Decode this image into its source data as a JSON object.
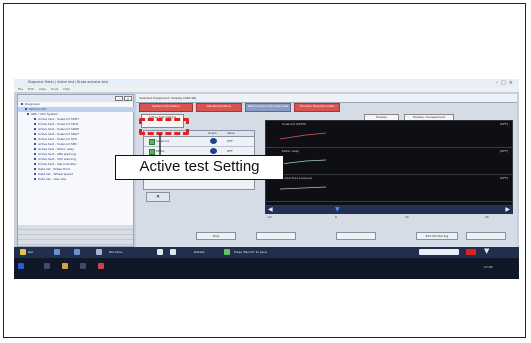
{
  "callout": {
    "label": "Active test Setting"
  },
  "window": {
    "title": "Diagnosis Tester | Active test | Brake actuator test",
    "menu": [
      "File",
      "Edit",
      "View",
      "Tools",
      "Help"
    ]
  },
  "tree": {
    "items": [
      "Diagnosis",
      "Vehicle info",
      "ABS / VSC System",
      "Active test - Solenoid SFRH",
      "Active test - Solenoid SFLH",
      "Active test - Solenoid SRRH",
      "Active test - Solenoid SRLH",
      "Active test - Solenoid STR",
      "Active test - Solenoid SMC",
      "Active test - Motor relay",
      "Active test - ABS warning",
      "Active test - VSC warning",
      "Active test - Slip indicator",
      "Data list - Brake fluid",
      "Data list - Wheel speed",
      "Data list - Yaw rate"
    ],
    "lower_rows": [
      "",
      "",
      "",
      ""
    ]
  },
  "header": {
    "title": "Selected Equipment: Display (ABS SB)"
  },
  "tabs": [
    {
      "label": "System Information"
    },
    {
      "label": "Adjustment Menu"
    },
    {
      "label": "Data monitor and Active test"
    },
    {
      "label": "Function Execution Data"
    }
  ],
  "toolbar": {
    "active_test_setting": "Active test Setting",
    "display": "Display",
    "display_management": "Display management"
  },
  "grid": {
    "columns": [
      "Item",
      "Graph",
      "Value"
    ],
    "rows": [
      {
        "name": "Solenoid",
        "value": "OFF"
      },
      {
        "name": "Motor",
        "value": "OFF"
      }
    ]
  },
  "scope": {
    "traces": [
      {
        "label": "Solenoid (SFRH)",
        "right": "[OFF]"
      },
      {
        "label": "Motor relay",
        "right": "[OFF]"
      },
      {
        "label": "Brake fluid pressure",
        "right": "[OFF]"
      }
    ]
  },
  "scale": {
    "ticks": [
      "-10",
      "0",
      "10",
      "20"
    ]
  },
  "bottom": {
    "stop": "Stop",
    "exit": "Exit Monitoring"
  },
  "taskbar": {
    "items": [
      "Rec",
      "Rec time",
      "Details",
      "Press 'Record' to save"
    ],
    "clock": "17:02"
  }
}
